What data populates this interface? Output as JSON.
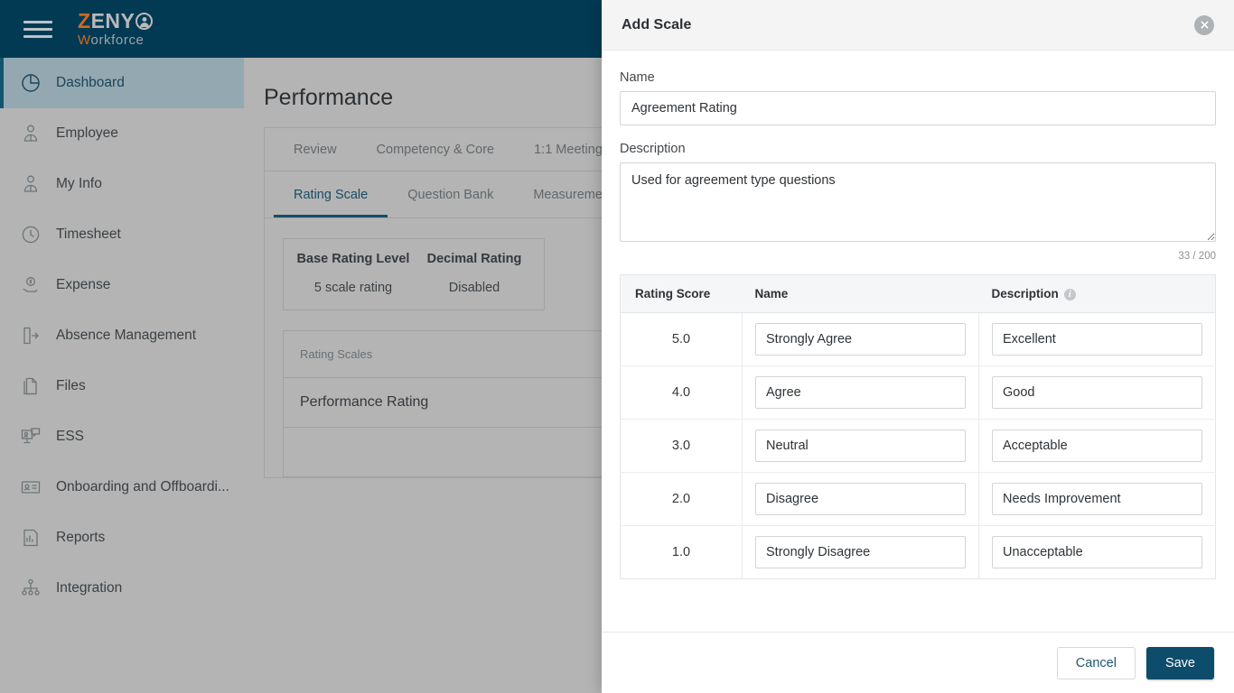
{
  "brand": {
    "logo_z": "Z",
    "logo_eny": "ENY",
    "logo_w": "W",
    "logo_orkforce": "orkforce",
    "header_color": "#023a54"
  },
  "sidebar": {
    "items": [
      {
        "label": "Dashboard",
        "icon": "pie-chart-icon",
        "active": true
      },
      {
        "label": "Employee",
        "icon": "employee-icon",
        "active": false
      },
      {
        "label": "My Info",
        "icon": "employee-icon",
        "active": false
      },
      {
        "label": "Timesheet",
        "icon": "clock-icon",
        "active": false
      },
      {
        "label": "Expense",
        "icon": "money-hand-icon",
        "active": false
      },
      {
        "label": "Absence Management",
        "icon": "door-exit-icon",
        "active": false
      },
      {
        "label": "Files",
        "icon": "documents-icon",
        "active": false
      },
      {
        "label": "ESS",
        "icon": "self-service-icon",
        "active": false
      },
      {
        "label": "Onboarding and Offboardi...",
        "icon": "id-card-icon",
        "active": false
      },
      {
        "label": "Reports",
        "icon": "report-icon",
        "active": false
      },
      {
        "label": "Integration",
        "icon": "hierarchy-icon",
        "active": false
      }
    ]
  },
  "main": {
    "page_title": "Performance",
    "tabs_primary": [
      {
        "label": "Review"
      },
      {
        "label": "Competency & Core"
      },
      {
        "label": "1:1 Meeting"
      }
    ],
    "tabs_secondary": [
      {
        "label": "Rating Scale",
        "active": true
      },
      {
        "label": "Question Bank",
        "active": false
      },
      {
        "label": "Measurements",
        "active": false
      }
    ],
    "info_card": {
      "headers": [
        "Base Rating Level",
        "Decimal Rating"
      ],
      "values": [
        "5 scale rating",
        "Disabled"
      ]
    },
    "list_card": {
      "header": "Rating Scales",
      "rows": [
        "Performance Rating"
      ]
    }
  },
  "modal": {
    "title": "Add Scale",
    "close_label": "close",
    "name": {
      "label": "Name",
      "value": "Agreement Rating",
      "placeholder": "Name"
    },
    "description": {
      "label": "Description",
      "value": "Used for agreement type questions",
      "placeholder": "Description",
      "counter": "33 / 200"
    },
    "table": {
      "columns": [
        "Rating Score",
        "Name",
        "Description"
      ],
      "description_has_info_icon": true,
      "rows": [
        {
          "score": "5.0",
          "name": "Strongly Agree",
          "description": "Excellent"
        },
        {
          "score": "4.0",
          "name": "Agree",
          "description": "Good"
        },
        {
          "score": "3.0",
          "name": "Neutral",
          "description": "Acceptable"
        },
        {
          "score": "2.0",
          "name": "Disagree",
          "description": "Needs Improvement"
        },
        {
          "score": "1.0",
          "name": "Strongly Disagree",
          "description": "Unacceptable"
        }
      ]
    },
    "footer": {
      "cancel_label": "Cancel",
      "save_label": "Save",
      "save_color": "#0d4c6a"
    }
  }
}
